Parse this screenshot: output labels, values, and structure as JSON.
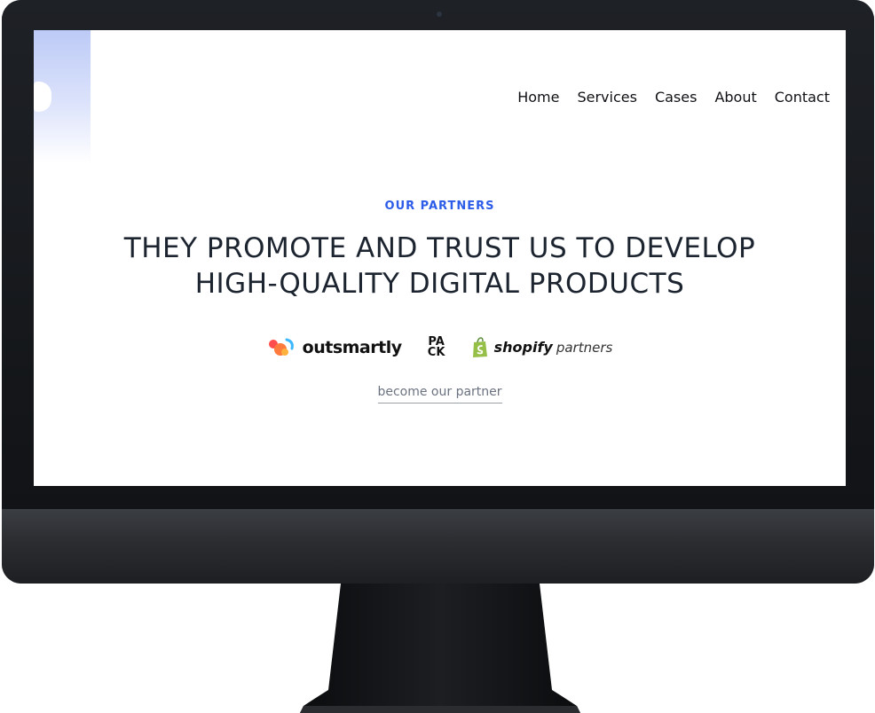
{
  "nav": {
    "items": [
      {
        "label": "Home"
      },
      {
        "label": "Services"
      },
      {
        "label": "Cases"
      },
      {
        "label": "About"
      },
      {
        "label": "Contact"
      }
    ]
  },
  "partners": {
    "eyebrow": "OUR PARTNERS",
    "headline_line1": "THEY PROMOTE AND TRUST US TO DEVELOP",
    "headline_line2": "HIGH-QUALITY DIGITAL PRODUCTS",
    "logos": [
      {
        "name": "outsmartly",
        "text": "outsmartly",
        "icon": "outsmartly-logo-icon"
      },
      {
        "name": "pack",
        "text_top": "PA",
        "text_bottom": "CK"
      },
      {
        "name": "shopify-partners",
        "text_bold": "shopify",
        "text_light": "partners",
        "icon": "shopify-bag-icon"
      }
    ],
    "cta_label": "become our partner"
  },
  "colors": {
    "accent": "#2d5de8",
    "heading": "#1c2430",
    "link": "#6b7280",
    "monitor_frame": "#15171b",
    "shopify_green": "#95bf47"
  }
}
